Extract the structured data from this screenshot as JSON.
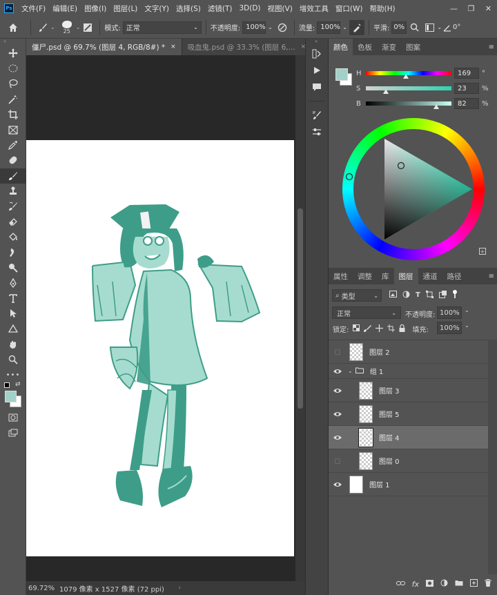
{
  "app": {
    "logo": "Ps"
  },
  "menu": [
    "文件(F)",
    "编辑(E)",
    "图像(I)",
    "图层(L)",
    "文字(Y)",
    "选择(S)",
    "滤镜(T)",
    "3D(D)",
    "视图(V)",
    "增效工具",
    "窗口(W)",
    "帮助(H)"
  ],
  "window_controls": [
    "—",
    "❐",
    "✕"
  ],
  "options": {
    "brush_size": "25",
    "mode_label": "模式:",
    "mode_value": "正常",
    "opacity_label": "不透明度:",
    "opacity_value": "100%",
    "flow_label": "流量:",
    "flow_value": "100%",
    "smooth_label": "平滑:",
    "smooth_value": "0%",
    "angle_value": "0°"
  },
  "tabs": [
    {
      "label": "僵尸.psd @ 69.7% (图层 4, RGB/8#) *",
      "close": "×"
    },
    {
      "label": "吸血鬼.psd @ 33.3% (图层 6,...",
      "close": "×"
    }
  ],
  "status": {
    "zoom": "69.72%",
    "info": "1079 像素 x 1527 像素 (72 ppi)"
  },
  "color_panel": {
    "tabs": [
      "颜色",
      "色板",
      "渐变",
      "图案"
    ],
    "h_label": "H",
    "h_value": "169",
    "h_unit": "°",
    "s_label": "S",
    "s_value": "23",
    "s_unit": "%",
    "b_label": "B",
    "b_value": "82",
    "b_unit": "%",
    "h_level": 0.47,
    "s_level": 0.23,
    "b_level": 0.82,
    "foreground": "#a1d1c9",
    "background": "#ffffff"
  },
  "layers_panel": {
    "tabs": [
      "属性",
      "调整",
      "库",
      "图层",
      "通道",
      "路径"
    ],
    "filter_label": "类型",
    "blend_mode": "正常",
    "opacity_label": "不透明度:",
    "opacity_value": "100%",
    "lock_label": "锁定:",
    "fill_label": "填充:",
    "fill_value": "100%",
    "layers": [
      {
        "name": "图层 2",
        "visible": false,
        "indent": false
      },
      {
        "name": "组 1",
        "visible": true,
        "group": true
      },
      {
        "name": "图层 3",
        "visible": true,
        "indent": true
      },
      {
        "name": "图层 5",
        "visible": true,
        "indent": true
      },
      {
        "name": "图层 4",
        "visible": true,
        "indent": true,
        "selected": true
      },
      {
        "name": "图层 0",
        "visible": false,
        "indent": true
      },
      {
        "name": "图层 1",
        "visible": true,
        "indent": false
      }
    ]
  },
  "colors": {
    "art": "#3d9d88",
    "art_light": "#a6dccf"
  }
}
